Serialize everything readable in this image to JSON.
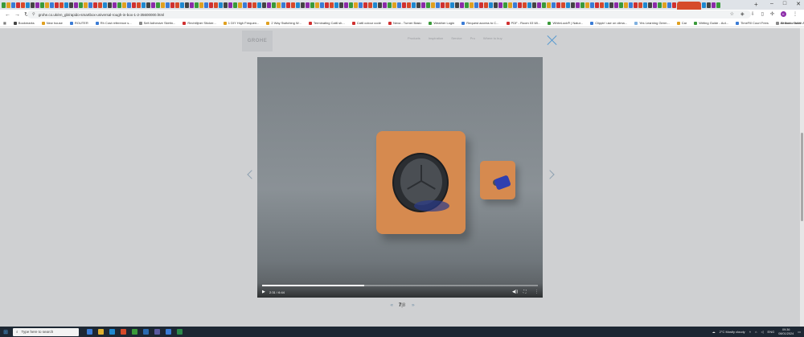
{
  "browser": {
    "tab_count": 145,
    "new_tab_glyph": "+",
    "url": "grohe.co.uk/en_gb/rapido-smartbox-universal-rough-in-box-1-2-35600000.html",
    "window_controls": [
      "–",
      "□",
      "✕"
    ],
    "profile_initial": "K"
  },
  "bookmarks": {
    "items": [
      {
        "label": "Bookmarks",
        "color": "#444444"
      },
      {
        "label": "New house",
        "color": "#e0a020"
      },
      {
        "label": "ROUTER",
        "color": "#3a7bd5"
      },
      {
        "label": "Rh Cost reference s...",
        "color": "#3a7bd5"
      },
      {
        "label": "Self Adhesive Skirtin...",
        "color": "#888888"
      },
      {
        "label": "Rechtlijner Sticker...",
        "color": "#d03030"
      },
      {
        "label": "1 DIY High Frequen...",
        "color": "#e0a020"
      },
      {
        "label": "2 Way Switching W...",
        "color": "#e0a020"
      },
      {
        "label": "Terminating Cat6 sh...",
        "color": "#d03030"
      },
      {
        "label": "Cat6 colour code",
        "color": "#d03030"
      },
      {
        "label": "Nexa - Turner Basic",
        "color": "#d03030"
      },
      {
        "label": "Weather Login",
        "color": "#3a9a3a"
      },
      {
        "label": "Request access to C...",
        "color": "#3a7bd5"
      },
      {
        "label": "PDF - Room 03 Wi...",
        "color": "#d03030"
      },
      {
        "label": "WhiteLock® | Natur...",
        "color": "#3a9a3a"
      },
      {
        "label": "Clippin' use on clima...",
        "color": "#3a7bd5"
      },
      {
        "label": "Yes Learning Germ...",
        "color": "#7fb0e0"
      },
      {
        "label": "Car",
        "color": "#e0a020"
      },
      {
        "label": "Writing Guide - Aut...",
        "color": "#3a9a3a"
      },
      {
        "label": "TimeFill Court Fees",
        "color": "#3a7bd5"
      },
      {
        "label": "Search - Tickfit Ai...",
        "color": "#888888"
      }
    ],
    "all_bookmarks": "All Bookmarks"
  },
  "site": {
    "logo_text": "GROHE",
    "nav": [
      "Products",
      "Inspiration",
      "Service",
      "Pro",
      "Where to buy"
    ]
  },
  "video": {
    "current_time": "2:31",
    "duration": "6:44",
    "progress_fraction": 0.37
  },
  "pager": {
    "current": "7",
    "separator": "|",
    "total": "8",
    "prev_glyph": "‹‹‹",
    "next_glyph": "›››"
  },
  "taskbar": {
    "search_placeholder": "Type here to search",
    "weather": "2°C  Mostly cloudy",
    "language": "ENG",
    "time": "09:36",
    "date": "08/01/2024"
  },
  "colors": {
    "tile": "#d68a4f",
    "valve": "#2f3fb0",
    "close_accent": "#5a9bd0",
    "taskbar": "#1d2733"
  }
}
